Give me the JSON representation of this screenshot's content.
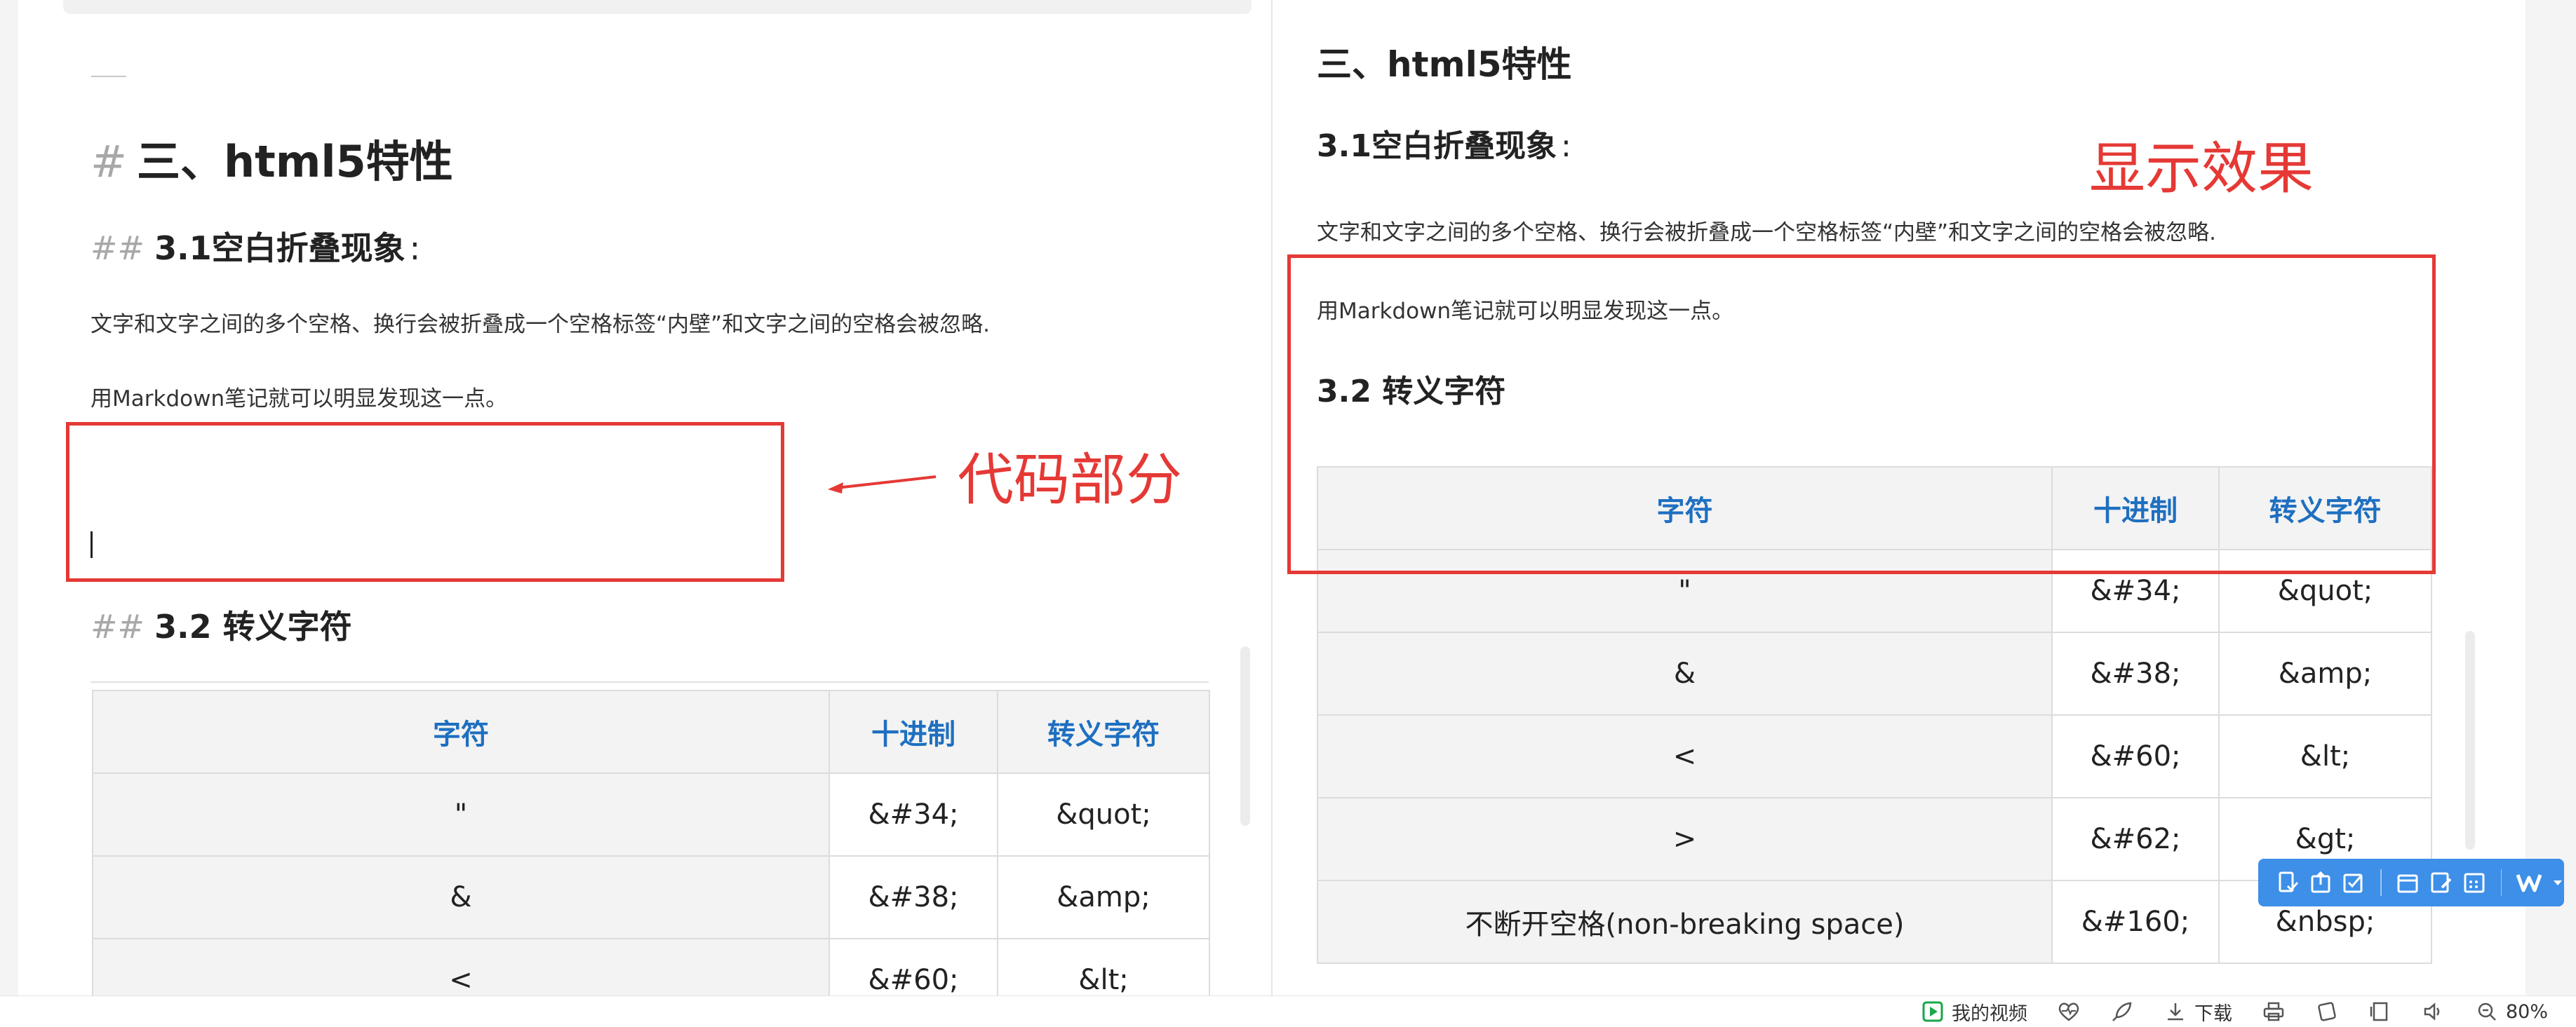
{
  "editor": {
    "h1_hash": "#",
    "h1_text": "三、html5特性",
    "h2_hash": "##",
    "h2a_text": "3.1空白折叠现象",
    "h2a_suffix": ":",
    "p1": "文字和文字之间的多个空格、换行会被折叠成一个空格标签“内壁”和文字之间的空格会被忽略.",
    "p2": "用Markdown笔记就可以明显发现这一点。",
    "h2b_text": "3.2 转义字符",
    "table": {
      "headers": [
        "字符",
        "十进制",
        "转义字符"
      ],
      "rows": [
        [
          "\"",
          "&#34;",
          "&quot;"
        ],
        [
          "&",
          "&#38;",
          "&amp;"
        ],
        [
          "<",
          "&#60;",
          "&lt;"
        ]
      ]
    }
  },
  "preview": {
    "h1_text": "三、html5特性",
    "h2a_text": "3.1空白折叠现象",
    "h2a_suffix": ":",
    "p1": "文字和文字之间的多个空格、换行会被折叠成一个空格标签“内壁”和文字之间的空格会被忽略.",
    "p2": "用Markdown笔记就可以明显发现这一点。",
    "h2b_text": "3.2 转义字符",
    "table": {
      "headers": [
        "字符",
        "十进制",
        "转义字符"
      ],
      "rows": [
        [
          "\"",
          "&#34;",
          "&quot;"
        ],
        [
          "&",
          "&#38;",
          "&amp;"
        ],
        [
          "<",
          "&#60;",
          "&lt;"
        ],
        [
          ">",
          "&#62;",
          "&gt;"
        ],
        [
          "不断开空格(non-breaking space)",
          "&#160;",
          "&nbsp;"
        ]
      ]
    }
  },
  "annotations": {
    "code_label": "代码部分",
    "display_label": "显示效果",
    "color": "#e53935"
  },
  "toolbar": {
    "icons": [
      "doc-check-icon",
      "doc-upload-icon",
      "checkbox-icon",
      "calendar-icon",
      "doc-edit-icon",
      "schedule-icon",
      "wps-logo-icon",
      "caret-down-icon"
    ],
    "color": "#3d8fe8"
  },
  "statusbar": {
    "my_video": "我的视频",
    "download": "下载",
    "zoom": "80%"
  }
}
